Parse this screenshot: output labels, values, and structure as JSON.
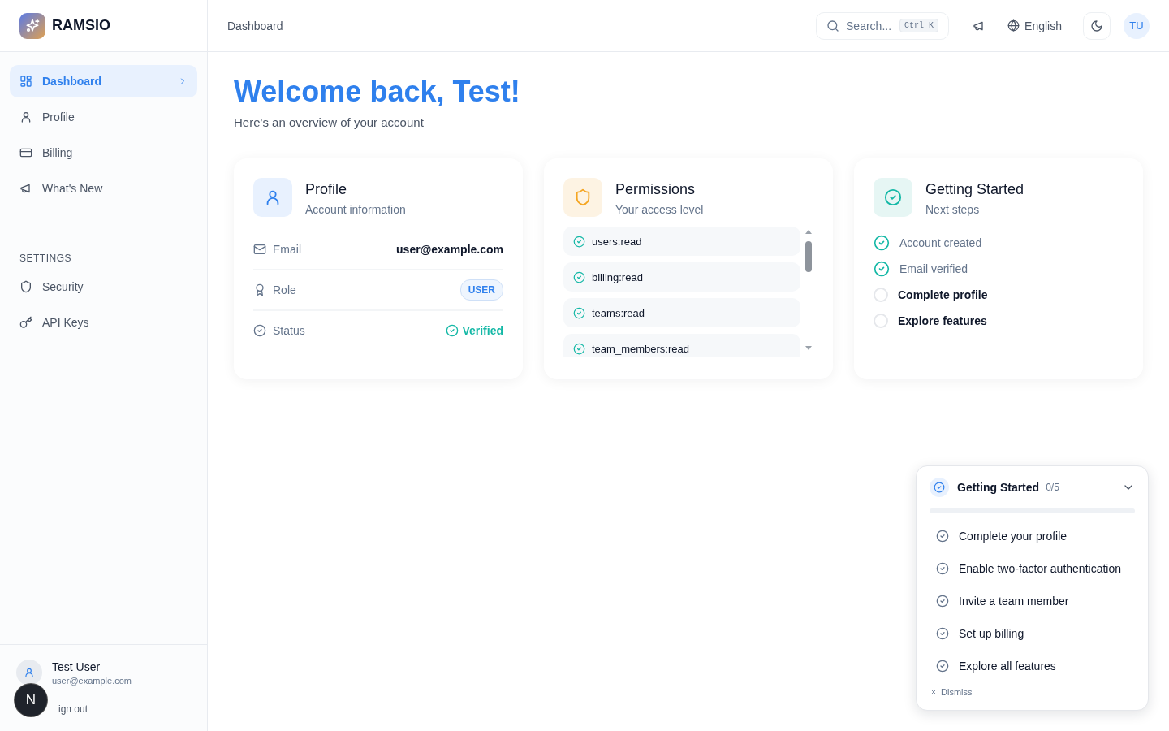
{
  "brand": {
    "name": "RAMSIO"
  },
  "sidebar": {
    "items": [
      {
        "label": "Dashboard",
        "selected": true
      },
      {
        "label": "Profile",
        "selected": false
      },
      {
        "label": "Billing",
        "selected": false
      },
      {
        "label": "What's New",
        "selected": false
      }
    ],
    "section_title": "SETTINGS",
    "settings_items": [
      {
        "label": "Security",
        "selected": false
      },
      {
        "label": "API Keys",
        "selected": false
      }
    ],
    "user": {
      "name": "Test User",
      "email": "user@example.com",
      "sign_out": "ign out"
    }
  },
  "dev_badge": {
    "label": "N"
  },
  "header": {
    "breadcrumb": "Dashboard",
    "search": {
      "label": "Search...",
      "shortcut": "Ctrl K"
    },
    "language": "English",
    "avatar": "TU"
  },
  "page": {
    "title": "Welcome back, Test!",
    "subtitle": "Here's an overview of your account"
  },
  "cards": [
    {
      "kind": "profile",
      "title": "Profile",
      "subtitle": "Account information",
      "rows": [
        {
          "kind": "text",
          "label": "Email",
          "value": "user@example.com"
        },
        {
          "kind": "badge",
          "label": "Role",
          "value": "USER"
        },
        {
          "kind": "status",
          "label": "Status",
          "value": "Verified"
        }
      ]
    },
    {
      "kind": "permissions",
      "title": "Permissions",
      "subtitle": "Your access level",
      "items": [
        "users:read",
        "billing:read",
        "teams:read",
        "team_members:read"
      ]
    },
    {
      "kind": "steps",
      "title": "Getting Started",
      "subtitle": "Next steps",
      "steps": [
        {
          "label": "Account created",
          "done": true
        },
        {
          "label": "Email verified",
          "done": true
        },
        {
          "label": "Complete profile",
          "done": false
        },
        {
          "label": "Explore features",
          "done": false
        }
      ]
    }
  ],
  "widget": {
    "title": "Getting Started",
    "count": "0/5",
    "level": 0,
    "items": [
      {
        "label": "Complete your profile",
        "done": false
      },
      {
        "label": "Enable two-factor authentication",
        "done": false
      },
      {
        "label": "Invite a team member",
        "done": false
      },
      {
        "label": "Set up billing",
        "done": false
      },
      {
        "label": "Explore all features",
        "done": false
      }
    ],
    "dismiss": "Dismiss"
  }
}
